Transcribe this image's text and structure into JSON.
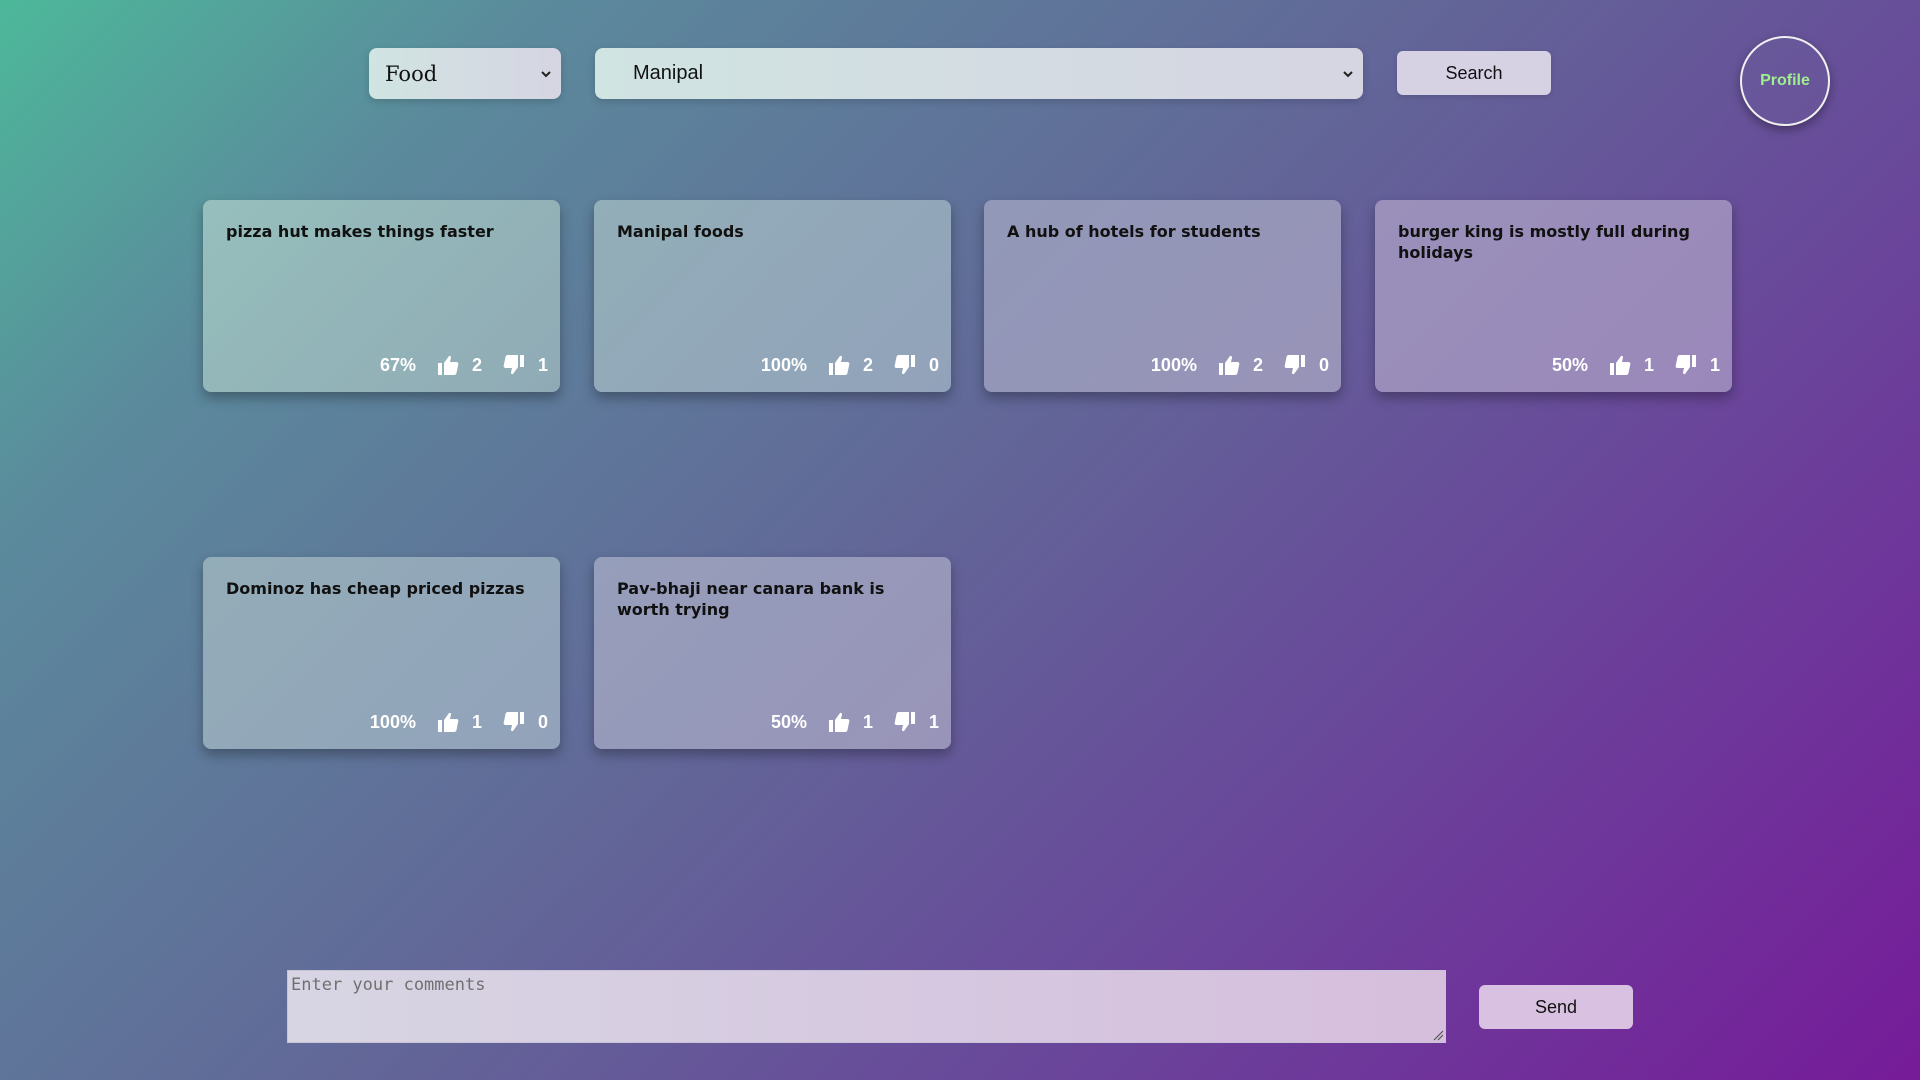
{
  "filters": {
    "category_value": "Food",
    "location_value": "Manipal",
    "search_label": "Search"
  },
  "profile_label": "Profile",
  "cards": [
    {
      "title": "pizza hut makes things faster",
      "percent": "67%",
      "likes": "2",
      "dislikes": "1"
    },
    {
      "title": "Manipal foods",
      "percent": "100%",
      "likes": "2",
      "dislikes": "0"
    },
    {
      "title": "A hub of hotels for students",
      "percent": "100%",
      "likes": "2",
      "dislikes": "0"
    },
    {
      "title": "burger king is mostly full during holidays",
      "percent": "50%",
      "likes": "1",
      "dislikes": "1"
    },
    {
      "title": "Dominoz has cheap priced pizzas",
      "percent": "100%",
      "likes": "1",
      "dislikes": "0"
    },
    {
      "title": "Pav-bhaji near canara bank is worth trying",
      "percent": "50%",
      "likes": "1",
      "dislikes": "1"
    }
  ],
  "comment": {
    "placeholder": "Enter your comments",
    "send_label": "Send"
  },
  "colors": {
    "profile_text": "#9ef08e",
    "stat_text": "#ffffff"
  },
  "icons": {
    "like": "thumbs-up-icon",
    "dislike": "thumbs-down-icon",
    "dropdown": "chevron-down-icon"
  }
}
